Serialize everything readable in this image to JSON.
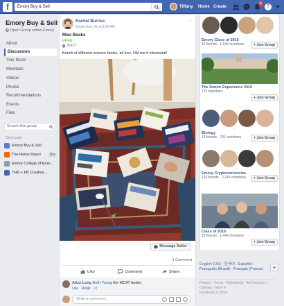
{
  "topbar": {
    "search_value": "Emory Buy & Sell",
    "user_name": "Tiffany",
    "home_label": "Home",
    "create_label": "Create",
    "notifications_badge": "1",
    "brand_color": "#4267b2"
  },
  "group": {
    "title": "Emory Buy & Sell",
    "subtitle": "Open Group within Emory",
    "nav": [
      "About",
      "Discussion",
      "Your Items",
      "Members",
      "Videos",
      "Photos",
      "Recommendations",
      "Events",
      "Files"
    ],
    "active_nav": "Discussion",
    "search_placeholder": "Search this group",
    "shortcuts_heading": "Shortcuts",
    "shortcuts": [
      {
        "label": "Emory Buy & Sell",
        "badge": ""
      },
      {
        "label": "The Home Depot",
        "badge": "20+"
      },
      {
        "label": "Emory College of Emo...",
        "badge": ""
      },
      {
        "label": "THD + FB Creative ...",
        "badge": ""
      }
    ]
  },
  "post": {
    "author": "Rachel Burriss",
    "time": "September 26 at 8:58 AM",
    "title": "Misc Books",
    "price": "FREE",
    "location": "30327",
    "description": "Bunch of different science books, all free. DM me if interested!",
    "message_button": "Message Seller",
    "comment_count": "1 Comment",
    "actions": {
      "like": "Like",
      "comment": "Comment",
      "share": "Share"
    },
    "comment": {
      "author": "Alice Long",
      "tag": "Beth Young",
      "text": "the MCAT books",
      "like": "Like",
      "reply": "Reply",
      "time": "2d"
    },
    "write_placeholder": "Write a comment..."
  },
  "suggestions": [
    {
      "name": "Emory Class of 2016",
      "meta": "41 friends · 1,542 members",
      "join": "+ Join Group"
    },
    {
      "name": "The Senior Experience 2019",
      "meta": "775 members",
      "join": "+ Join Group"
    },
    {
      "name": "Biology",
      "meta": "13 friends · 781 members",
      "join": "+ Join Group"
    },
    {
      "name": "Emory Cryptocurrencies",
      "meta": "126 friends · 2,241 members",
      "join": "+ Join Group"
    },
    {
      "name": "Class of 2015",
      "meta": "19 friends · 1,446 members",
      "join": "+ Join Group"
    }
  ],
  "languages": {
    "current": "English (US)",
    "others": "· 한국어 · Español · Português (Brasil) · Français (France)",
    "add": "+"
  },
  "footer": {
    "links": "Privacy · Terms · Advertising · Ad Choices ▷ · Cookies · More ▾",
    "copyright": "Facebook © 2019"
  }
}
